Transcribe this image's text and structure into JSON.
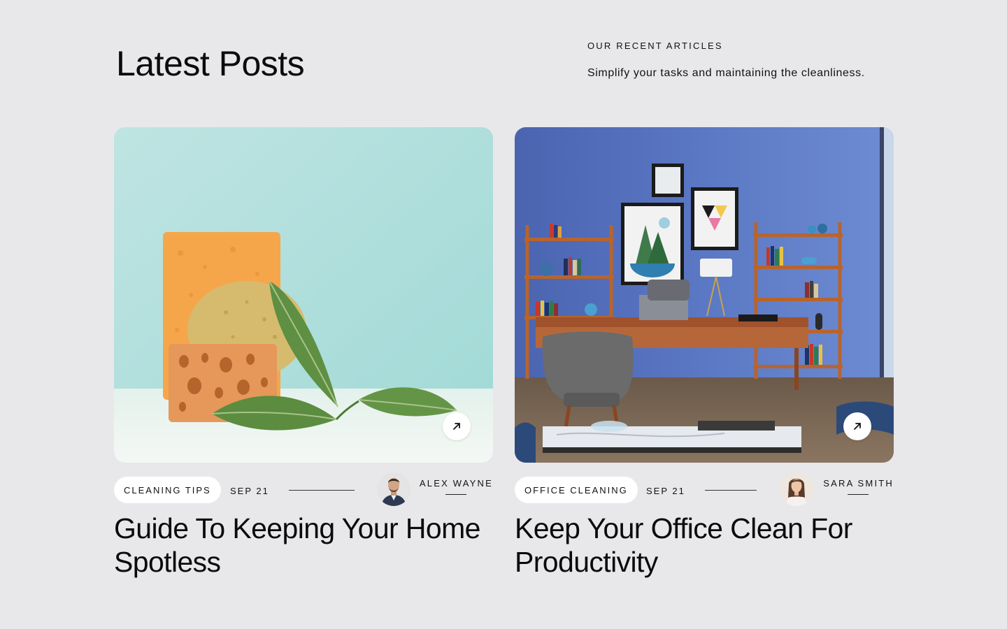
{
  "header": {
    "title": "Latest Posts",
    "eyebrow": "OUR RECENT ARTICLES",
    "subtitle": "Simplify your tasks and maintaining the cleanliness."
  },
  "posts": [
    {
      "category": "CLEANING TIPS",
      "date": "SEP 21",
      "author": "ALEX WAYNE",
      "title": "Guide To Keeping Your Home Spotless",
      "image": "sponges-and-plant-leaves",
      "link_icon": "arrow-up-right-icon"
    },
    {
      "category": "OFFICE CLEANING",
      "date": "SEP 21",
      "author": "SARA SMITH",
      "title": "Keep Your Office Clean For Productivity",
      "image": "blue-home-office-interior",
      "link_icon": "arrow-up-right-icon"
    }
  ],
  "colors": {
    "background": "#e8e8ea",
    "pill": "#ffffff",
    "text": "#111111"
  }
}
